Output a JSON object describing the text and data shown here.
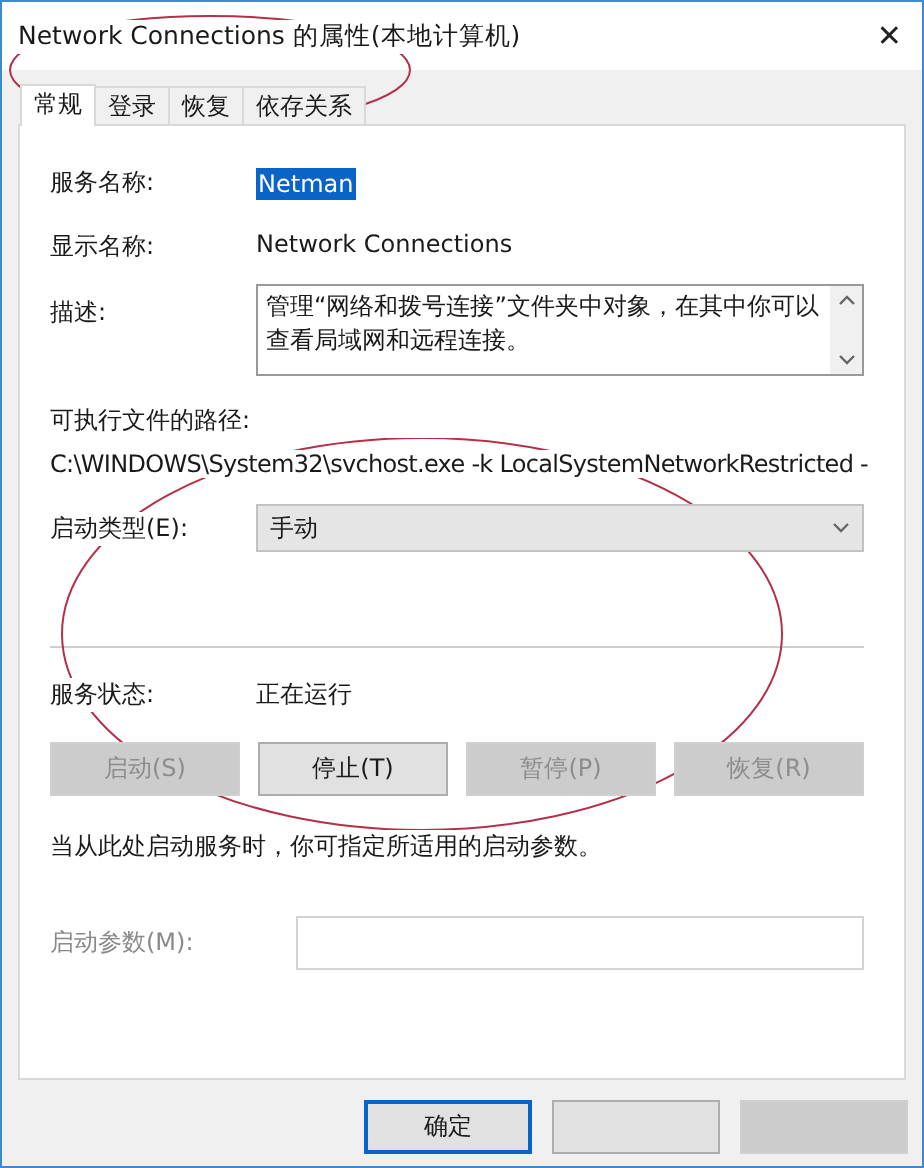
{
  "window": {
    "title": "Network Connections 的属性(本地计算机)",
    "close": "✕"
  },
  "tabs": [
    {
      "label": "常规",
      "selected": true
    },
    {
      "label": "登录",
      "selected": false
    },
    {
      "label": "恢复",
      "selected": false
    },
    {
      "label": "依存关系",
      "selected": false
    }
  ],
  "service_name": {
    "label": "服务名称:",
    "value": "Netman",
    "selected": true
  },
  "display_name": {
    "label": "显示名称:",
    "value": "Network Connections"
  },
  "description": {
    "label": "描述:",
    "value": "管理“网络和拨号连接”文件夹中对象，在其中你可以查看局域网和远程连接。"
  },
  "path": {
    "label": "可执行文件的路径:",
    "value": "C:\\WINDOWS\\System32\\svchost.exe -k LocalSystemNetworkRestricted -"
  },
  "startup_type": {
    "label": "启动类型(E):",
    "value": "手动"
  },
  "status": {
    "label": "服务状态:",
    "value": "正在运行"
  },
  "service_buttons": [
    {
      "label": "启动(S)",
      "disabled": true
    },
    {
      "label": "停止(T)",
      "disabled": false
    },
    {
      "label": "暂停(P)",
      "disabled": true
    },
    {
      "label": "恢复(R)",
      "disabled": true
    }
  ],
  "note": "当从此处启动服务时，你可指定所适用的启动参数。",
  "start_params": {
    "label": "启动参数(M):",
    "disabled": true
  },
  "dialog_buttons": [
    {
      "label": "确定",
      "default": true,
      "disabled": false
    },
    {
      "default": false,
      "disabled": false
    },
    {
      "default": false,
      "disabled": true
    }
  ],
  "annotations": [
    {
      "kind": "ellipse"
    },
    {
      "kind": "ellipse"
    }
  ]
}
